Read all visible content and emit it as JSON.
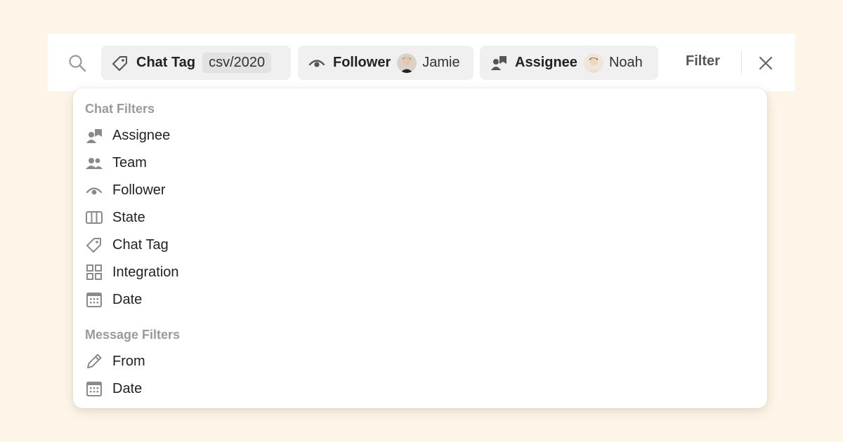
{
  "filter_bar": {
    "chips": [
      {
        "label": "Chat Tag",
        "value": "csv/2020",
        "icon": "tag-icon"
      },
      {
        "label": "Follower",
        "value": "Jamie",
        "icon": "eye-icon"
      },
      {
        "label": "Assignee",
        "value": "Noah",
        "icon": "assignee-icon"
      }
    ],
    "filter_label": "Filter"
  },
  "dropdown": {
    "chat_filters_header": "Chat Filters",
    "chat_filters": [
      {
        "label": "Assignee",
        "icon": "assignee-icon"
      },
      {
        "label": "Team",
        "icon": "team-icon"
      },
      {
        "label": "Follower",
        "icon": "eye-icon"
      },
      {
        "label": "State",
        "icon": "columns-icon"
      },
      {
        "label": "Chat Tag",
        "icon": "tag-icon"
      },
      {
        "label": "Integration",
        "icon": "grid-icon"
      },
      {
        "label": "Date",
        "icon": "calendar-icon"
      }
    ],
    "message_filters_header": "Message Filters",
    "message_filters": [
      {
        "label": "From",
        "icon": "pencil-icon"
      },
      {
        "label": "Date",
        "icon": "calendar-icon"
      }
    ]
  },
  "colors": {
    "page_background": "#fdf6e8",
    "chip_background": "#f0f0f0",
    "icon_gray": "#8a8a8a"
  }
}
